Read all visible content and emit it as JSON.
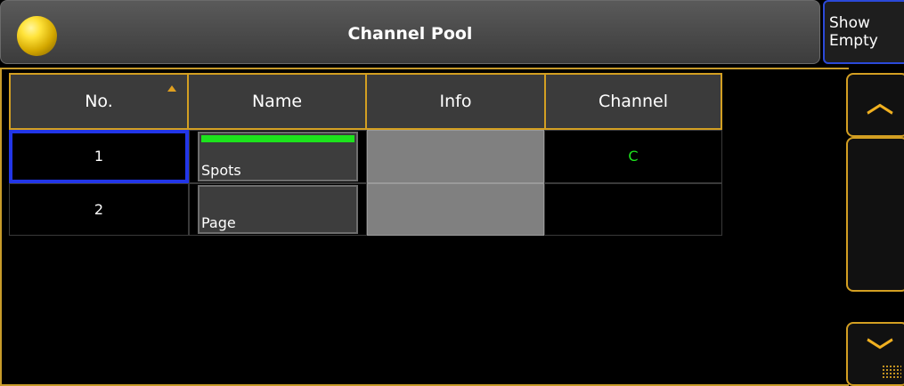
{
  "titlebar": {
    "title": "Channel Pool",
    "orb_color": "#f2c918"
  },
  "show_empty": {
    "line1": "Show",
    "line2": "Empty"
  },
  "table": {
    "headers": [
      "No.",
      "Name",
      "Info",
      "Channel"
    ],
    "sort_indicator": "sort-ascending-arrow",
    "rows": [
      {
        "no": "1",
        "name": "Spots",
        "info": "",
        "channel": "C",
        "has_channel_bar": true
      },
      {
        "no": "2",
        "name": "Page",
        "info": "",
        "channel": "",
        "has_channel_bar": false
      }
    ]
  },
  "scroll": {
    "up_icon": "chevron-up-icon",
    "down_icon": "chevron-down-icon"
  },
  "colors": {
    "accent": "#d39f22",
    "selection": "#2236e8",
    "channel_text": "#1de41d",
    "channel_bar": "#1de41d"
  }
}
